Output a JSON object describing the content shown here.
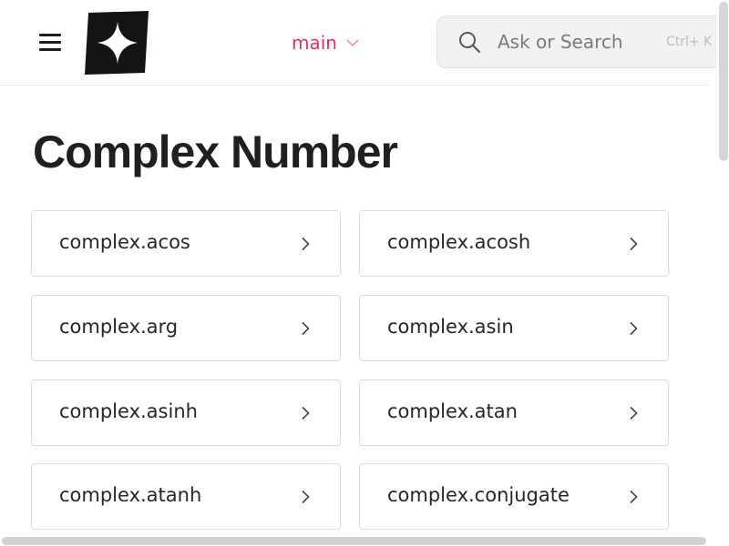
{
  "header": {
    "branch": "main",
    "search": {
      "placeholder": "Ask or Search",
      "shortcut": "Ctrl+ K"
    }
  },
  "page": {
    "title": "Complex Number"
  },
  "cards": [
    {
      "label": "complex.acos"
    },
    {
      "label": "complex.acosh"
    },
    {
      "label": "complex.arg"
    },
    {
      "label": "complex.asin"
    },
    {
      "label": "complex.asinh"
    },
    {
      "label": "complex.atan"
    },
    {
      "label": "complex.atanh"
    },
    {
      "label": "complex.conjugate"
    }
  ],
  "colors": {
    "accent": "#e0336a",
    "text": "#1f1f1f",
    "border": "#dedede"
  }
}
